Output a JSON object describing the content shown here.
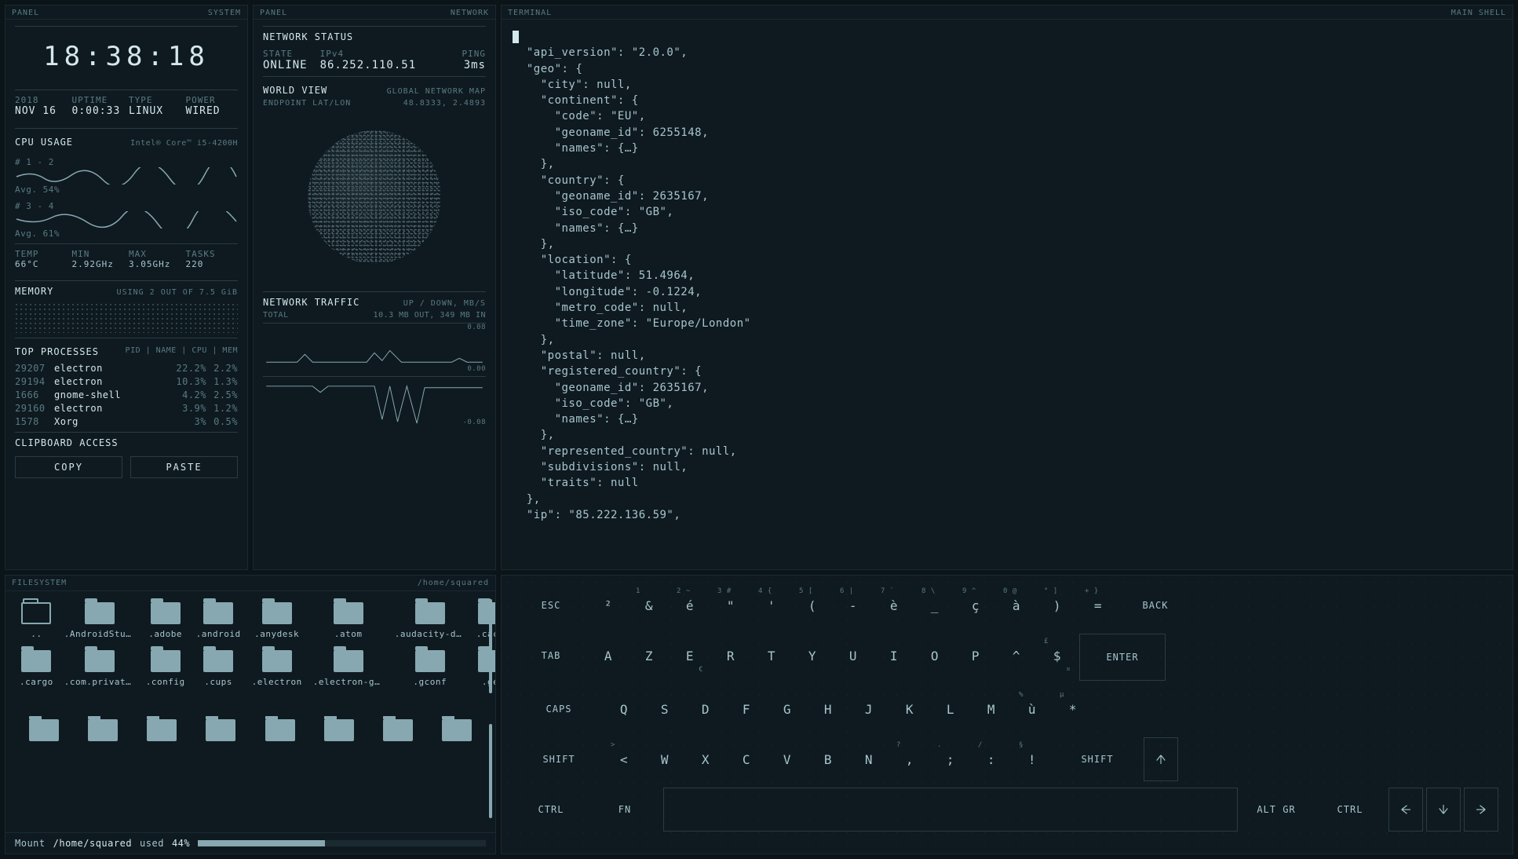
{
  "panels": {
    "system": {
      "left": "PANEL",
      "right": "SYSTEM"
    },
    "network": {
      "left": "PANEL",
      "right": "NETWORK"
    },
    "terminal": {
      "left": "TERMINAL",
      "right": "MAIN SHELL"
    },
    "filesystem": {
      "left": "FILESYSTEM",
      "right": "/home/squared"
    }
  },
  "clock": "18:38:18",
  "sysinfo": {
    "labels": {
      "date": "2018",
      "uptime": "UPTIME",
      "type": "TYPE",
      "power": "POWER"
    },
    "values": {
      "date": "NOV 16",
      "uptime": "0:00:33",
      "type": "LINUX",
      "power": "WIRED"
    }
  },
  "cpu": {
    "title": "CPU USAGE",
    "model": "Intel® Core™ i5-4200H",
    "cores": [
      {
        "name": "# 1 - 2",
        "avg": "Avg. 54%"
      },
      {
        "name": "# 3 - 4",
        "avg": "Avg. 61%"
      }
    ],
    "stats": {
      "labels": {
        "temp": "TEMP",
        "min": "MIN",
        "max": "MAX",
        "tasks": "TASKS"
      },
      "values": {
        "temp": "66°C",
        "min": "2.92GHz",
        "max": "3.05GHz",
        "tasks": "220"
      }
    }
  },
  "memory": {
    "title": "MEMORY",
    "usage": "USING 2 OUT OF 7.5 GiB"
  },
  "processes": {
    "title": "TOP PROCESSES",
    "cols": "PID | NAME | CPU | MEM",
    "rows": [
      {
        "pid": "29207",
        "name": "electron",
        "cpu": "22.2%",
        "mem": "2.2%"
      },
      {
        "pid": "29194",
        "name": "electron",
        "cpu": "10.3%",
        "mem": "1.3%"
      },
      {
        "pid": "1666",
        "name": "gnome-shell",
        "cpu": "4.2%",
        "mem": "2.5%"
      },
      {
        "pid": "29160",
        "name": "electron",
        "cpu": "3.9%",
        "mem": "1.2%"
      },
      {
        "pid": "1578",
        "name": "Xorg",
        "cpu": "3%",
        "mem": "0.5%"
      }
    ]
  },
  "clipboard": {
    "title": "CLIPBOARD ACCESS",
    "copy": "COPY",
    "paste": "PASTE"
  },
  "network": {
    "status_title": "NETWORK STATUS",
    "state_label": "STATE",
    "state_value": "ONLINE",
    "ipv4_label": "IPv4",
    "ipv4_value": "86.252.110.51",
    "ping_label": "PING",
    "ping_value": "3ms",
    "world_title": "WORLD VIEW",
    "world_sub_left": "ENDPOINT LAT/LON",
    "world_sub_right": "GLOBAL NETWORK MAP",
    "world_coords": "48.8333, 2.4893",
    "traffic_title": "NETWORK TRAFFIC",
    "traffic_sub_right": "UP / DOWN, MB/S",
    "traffic_total_label": "TOTAL",
    "traffic_total_value": "10.3 MB OUT, 349 MB IN",
    "tick_up_hi": "0.08",
    "tick_mid": "0.00",
    "tick_dn_lo": "-0.08"
  },
  "terminal_text": "  \"api_version\": \"2.0.0\",\n  \"geo\": {\n    \"city\": null,\n    \"continent\": {\n      \"code\": \"EU\",\n      \"geoname_id\": 6255148,\n      \"names\": {…}\n    },\n    \"country\": {\n      \"geoname_id\": 2635167,\n      \"iso_code\": \"GB\",\n      \"names\": {…}\n    },\n    \"location\": {\n      \"latitude\": 51.4964,\n      \"longitude\": -0.1224,\n      \"metro_code\": null,\n      \"time_zone\": \"Europe/London\"\n    },\n    \"postal\": null,\n    \"registered_country\": {\n      \"geoname_id\": 2635167,\n      \"iso_code\": \"GB\",\n      \"names\": {…}\n    },\n    \"represented_country\": null,\n    \"subdivisions\": null,\n    \"traits\": null\n  },\n  \"ip\": \"85.222.136.59\",",
  "filesystem": {
    "folders": [
      "..",
      ".AndroidStudi…",
      ".adobe",
      ".android",
      ".anydesk",
      ".atom",
      ".audacity-data",
      ".cache",
      ".cargo",
      ".com.privatei…",
      ".config",
      ".cups",
      ".electron",
      ".electron-gyp",
      ".gconf",
      ".gem"
    ],
    "footer_mount": "Mount ",
    "footer_path": "/home/squared",
    "footer_used_label": " used ",
    "footer_used_pct": "44%",
    "progress_pct": 44
  },
  "keyboard": {
    "row1_mods": {
      "esc": "ESC",
      "back": "BACK"
    },
    "row1": [
      {
        "m": "²",
        "s": ""
      },
      {
        "m": "&",
        "s": "1"
      },
      {
        "m": "é",
        "s": "2   ~"
      },
      {
        "m": "\"",
        "s": "3   #"
      },
      {
        "m": "'",
        "s": "4   {"
      },
      {
        "m": "(",
        "s": "5   ["
      },
      {
        "m": "-",
        "s": "6   |"
      },
      {
        "m": "è",
        "s": "7   `"
      },
      {
        "m": "_",
        "s": "8   \\"
      },
      {
        "m": "ç",
        "s": "9   ^"
      },
      {
        "m": "à",
        "s": "0   @"
      },
      {
        "m": ")",
        "s": "°   ]"
      },
      {
        "m": "=",
        "s": "+   }"
      }
    ],
    "row2_mods": {
      "tab": "TAB",
      "enter": "ENTER"
    },
    "row2": [
      {
        "m": "A"
      },
      {
        "m": "Z"
      },
      {
        "m": "E",
        "sub": "€"
      },
      {
        "m": "R"
      },
      {
        "m": "T"
      },
      {
        "m": "Y"
      },
      {
        "m": "U"
      },
      {
        "m": "I"
      },
      {
        "m": "O"
      },
      {
        "m": "P"
      },
      {
        "m": "^",
        "sub": ""
      },
      {
        "m": "$",
        "s": "£",
        "sub": "¤"
      }
    ],
    "row3_mods": {
      "caps": "CAPS"
    },
    "row3": [
      {
        "m": "Q"
      },
      {
        "m": "S"
      },
      {
        "m": "D"
      },
      {
        "m": "F"
      },
      {
        "m": "G"
      },
      {
        "m": "H"
      },
      {
        "m": "J"
      },
      {
        "m": "K"
      },
      {
        "m": "L"
      },
      {
        "m": "M"
      },
      {
        "m": "ù",
        "s": "%"
      },
      {
        "m": "*",
        "s": "µ"
      }
    ],
    "row4_mods": {
      "shift_l": "SHIFT",
      "shift_r": "SHIFT"
    },
    "row4": [
      {
        "m": "<",
        "s": ">"
      },
      {
        "m": "W"
      },
      {
        "m": "X"
      },
      {
        "m": "C"
      },
      {
        "m": "V"
      },
      {
        "m": "B"
      },
      {
        "m": "N"
      },
      {
        "m": ",",
        "s": "?"
      },
      {
        "m": ";",
        "s": "."
      },
      {
        "m": ":",
        "s": "/"
      },
      {
        "m": "!",
        "s": "§"
      }
    ],
    "row5_mods": {
      "ctrl_l": "CTRL",
      "fn": "FN",
      "altgr": "ALT GR",
      "ctrl_r": "CTRL"
    }
  }
}
